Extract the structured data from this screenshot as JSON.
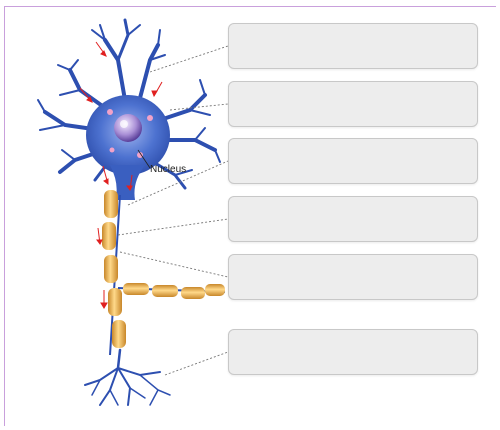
{
  "diagram": {
    "nucleus_label": "Nucleus"
  },
  "drop_zones": [
    {
      "id": "zone-1",
      "value": ""
    },
    {
      "id": "zone-2",
      "value": ""
    },
    {
      "id": "zone-3",
      "value": ""
    },
    {
      "id": "zone-4",
      "value": ""
    },
    {
      "id": "zone-5",
      "value": ""
    },
    {
      "id": "zone-6",
      "value": ""
    }
  ],
  "colors": {
    "cell_body": "#3a62c4",
    "myelin": "#e8b45a",
    "arrow": "#e02020",
    "leader": "#777777",
    "frame": "#c9a0dc"
  }
}
